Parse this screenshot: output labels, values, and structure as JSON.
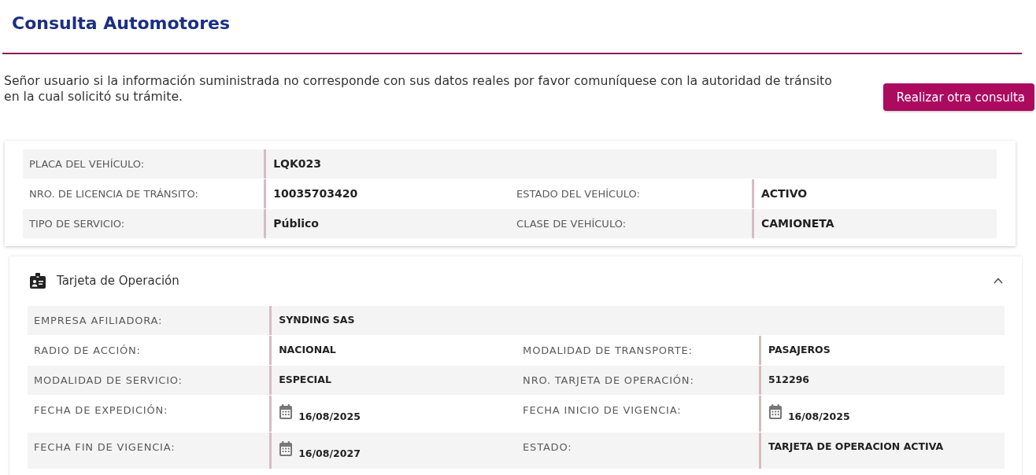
{
  "page": {
    "title": "Consulta Automotores"
  },
  "notice": {
    "text": "Señor usuario si la información suministrada no corresponde con sus datos reales por favor comuníquese con la autoridad de tránsito en la cual solicitó su trámite."
  },
  "actions": [
    {
      "label": "Realizar otra consulta"
    }
  ],
  "vehicle": {
    "rows": [
      {
        "fields": [
          {
            "label": "PLACA DEL VEHÍCULO:",
            "value": "LQK023"
          }
        ]
      },
      {
        "fields": [
          {
            "label": "NRO. DE LICENCIA DE TRÁNSITO:",
            "value": "10035703420"
          },
          {
            "label": "ESTADO DEL VEHÍCULO:",
            "value": "ACTIVO"
          }
        ]
      },
      {
        "fields": [
          {
            "label": "TIPO DE SERVICIO:",
            "value": "Público"
          },
          {
            "label": "CLASE DE VEHÍCULO:",
            "value": "CAMIONETA"
          }
        ]
      }
    ]
  },
  "operation_card": {
    "title": "Tarjeta de Operación",
    "expanded": true,
    "rows": [
      {
        "fields": [
          {
            "kind": "text",
            "label": "EMPRESA AFILIADORA:",
            "value": "SYNDING SAS"
          }
        ]
      },
      {
        "fields": [
          {
            "kind": "text",
            "label": "RADIO DE ACCIÓN:",
            "value": "NACIONAL"
          },
          {
            "kind": "text",
            "label": "MODALIDAD DE TRANSPORTE:",
            "value": "PASAJEROS"
          }
        ]
      },
      {
        "fields": [
          {
            "kind": "text",
            "label": "MODALIDAD DE SERVICIO:",
            "value": "ESPECIAL"
          },
          {
            "kind": "text",
            "label": "NRO. TARJETA DE OPERACIÓN:",
            "value": "512296"
          }
        ]
      },
      {
        "fields": [
          {
            "kind": "date",
            "label": "FECHA DE EXPEDICIÓN:",
            "value": "16/08/2025"
          },
          {
            "kind": "date",
            "label": "FECHA INICIO DE VIGENCIA:",
            "value": "16/08/2025"
          }
        ]
      },
      {
        "fields": [
          {
            "kind": "date",
            "label": "FECHA FIN DE VIGENCIA:",
            "value": "16/08/2027"
          },
          {
            "kind": "text",
            "label": "ESTADO:",
            "value": "TARJETA DE OPERACION ACTIVA"
          }
        ]
      }
    ]
  }
}
